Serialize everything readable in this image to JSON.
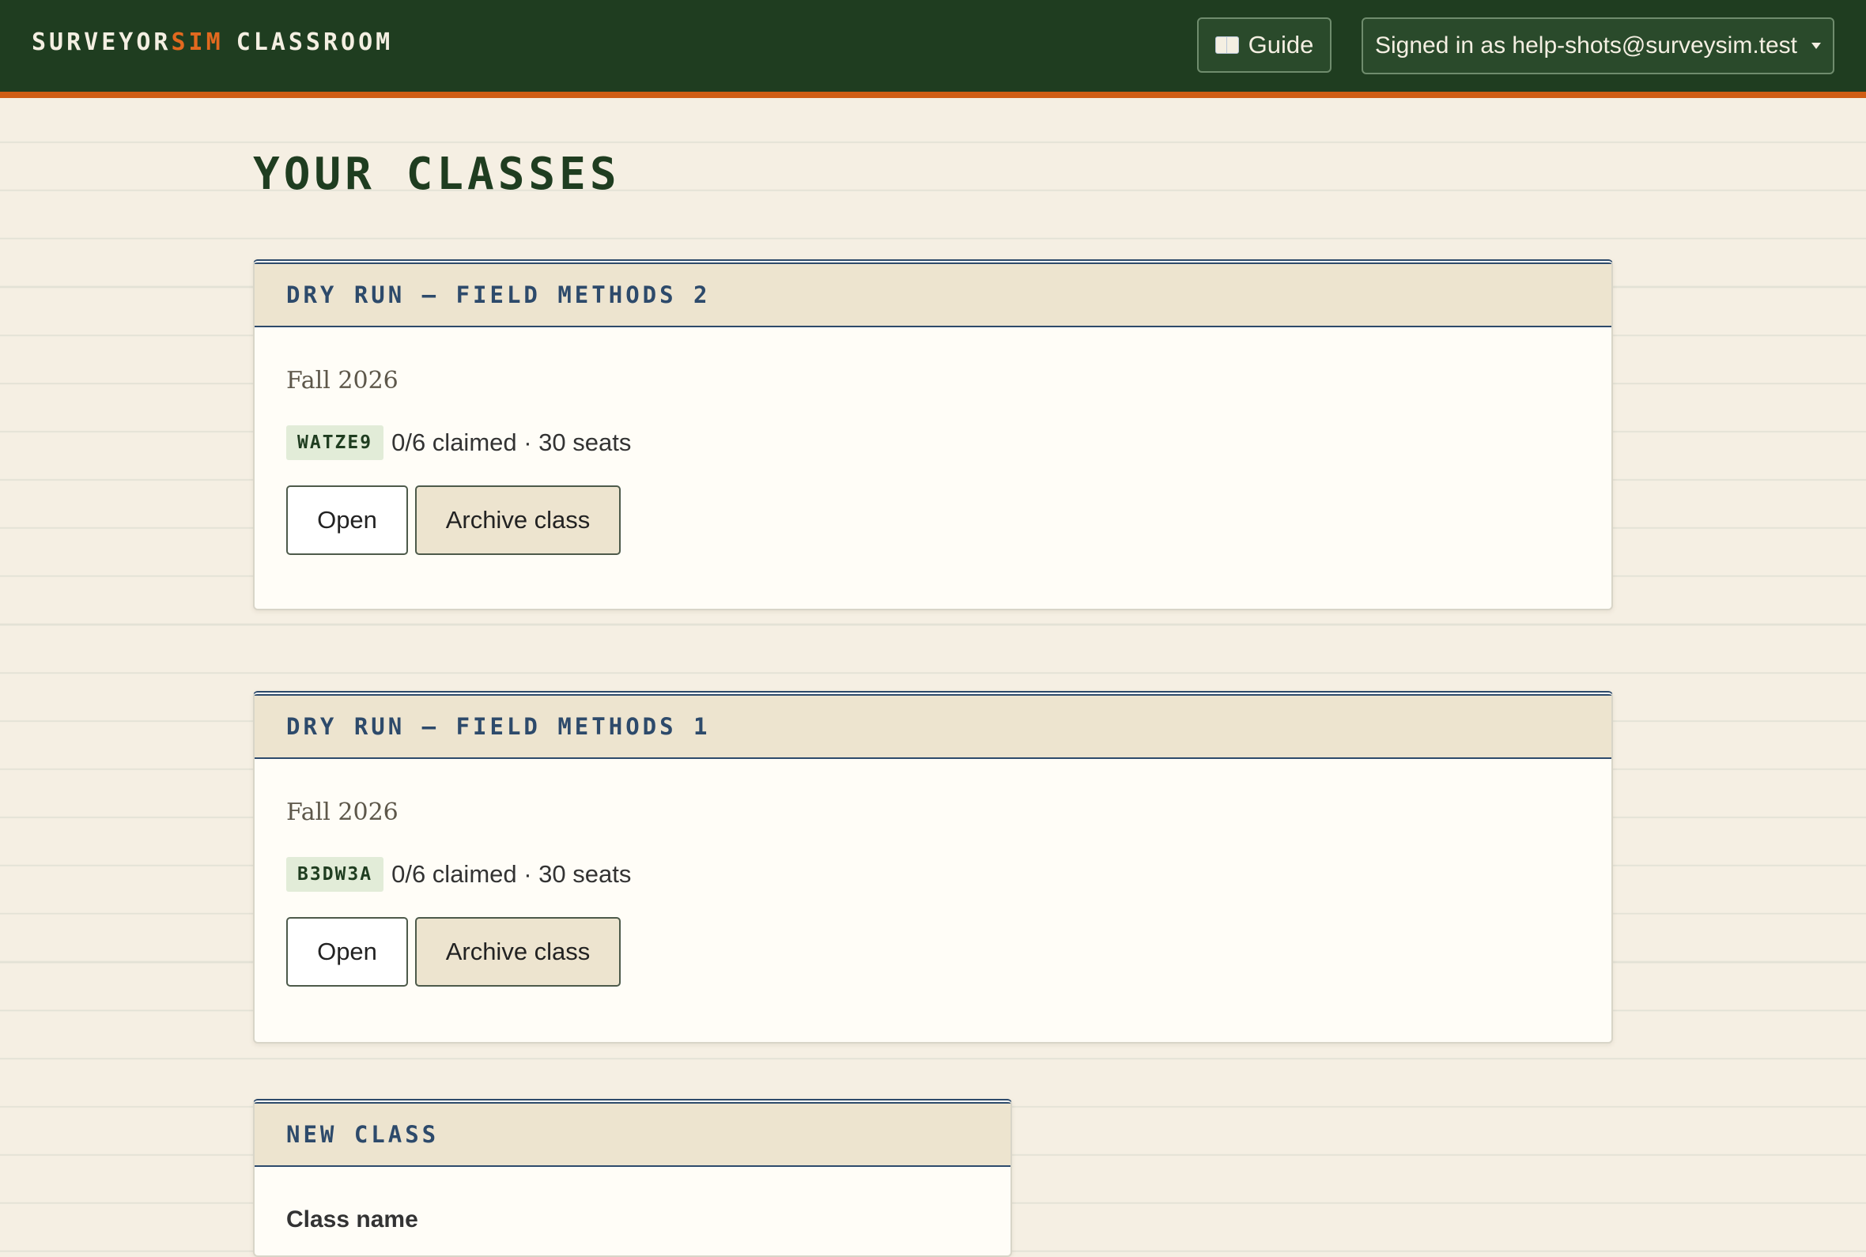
{
  "header": {
    "brand_part1": "SURVEYOR",
    "brand_accent": "SIM",
    "brand_part2": "CLASSROOM",
    "guide_label": "Guide",
    "guide_icon": "book-icon",
    "user_label": "Signed in as help-shots@surveysim.test",
    "colors": {
      "bar": "#1f3d20",
      "accent": "#cf5d14"
    }
  },
  "page": {
    "title": "YOUR CLASSES"
  },
  "classes": [
    {
      "title": "DRY RUN — FIELD METHODS 2",
      "term": "Fall 2026",
      "code": "WATZE9",
      "stats": "0/6 claimed · 30 seats",
      "open_label": "Open",
      "archive_label": "Archive class"
    },
    {
      "title": "DRY RUN — FIELD METHODS 1",
      "term": "Fall 2026",
      "code": "B3DW3A",
      "stats": "0/6 claimed · 30 seats",
      "open_label": "Open",
      "archive_label": "Archive class"
    }
  ],
  "new_class": {
    "title": "NEW CLASS",
    "name_label": "Class name"
  }
}
